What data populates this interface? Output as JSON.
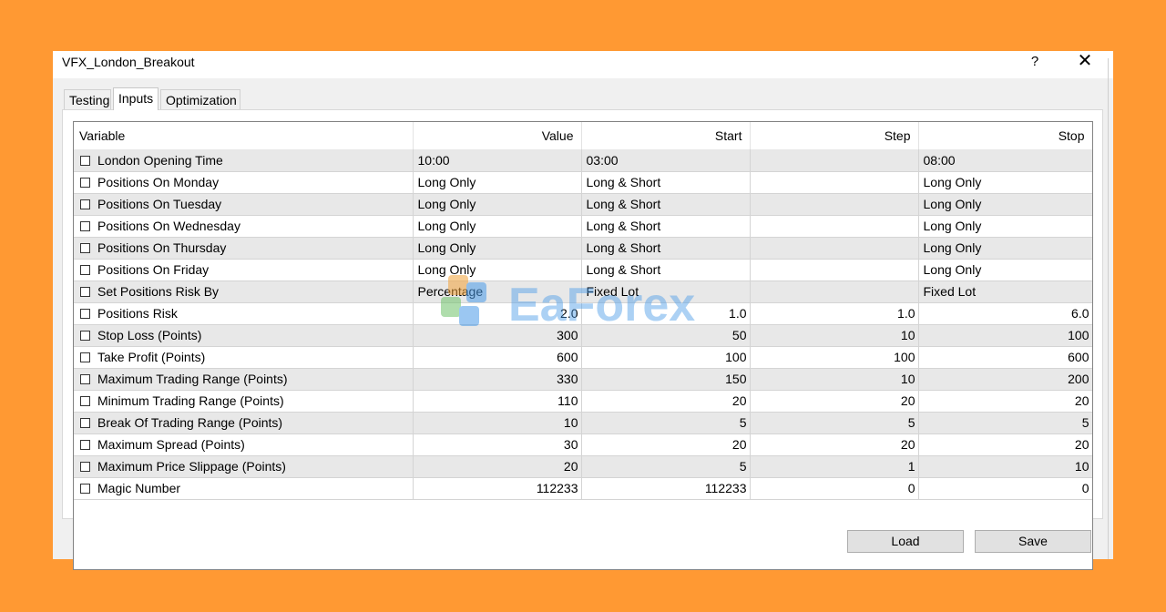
{
  "window": {
    "title": "VFX_London_Breakout",
    "help_label": "?",
    "close_label": "✕"
  },
  "tabs": [
    {
      "label": "Testing",
      "active": false
    },
    {
      "label": "Inputs",
      "active": true
    },
    {
      "label": "Optimization",
      "active": false
    }
  ],
  "table": {
    "headers": [
      "Variable",
      "Value",
      "Start",
      "Step",
      "Stop"
    ],
    "rows": [
      {
        "checked": false,
        "variable": "London Opening Time",
        "value": "10:00",
        "start": "03:00",
        "step": "",
        "stop": "08:00",
        "align": "txt"
      },
      {
        "checked": false,
        "variable": "Positions On Monday",
        "value": "Long Only",
        "start": "Long & Short",
        "step": "",
        "stop": "Long Only",
        "align": "txt"
      },
      {
        "checked": false,
        "variable": "Positions On Tuesday",
        "value": "Long Only",
        "start": "Long & Short",
        "step": "",
        "stop": "Long Only",
        "align": "txt"
      },
      {
        "checked": false,
        "variable": "Positions On Wednesday",
        "value": "Long Only",
        "start": "Long & Short",
        "step": "",
        "stop": "Long Only",
        "align": "txt"
      },
      {
        "checked": false,
        "variable": "Positions On Thursday",
        "value": "Long Only",
        "start": "Long & Short",
        "step": "",
        "stop": "Long Only",
        "align": "txt"
      },
      {
        "checked": false,
        "variable": "Positions On Friday",
        "value": "Long Only",
        "start": "Long & Short",
        "step": "",
        "stop": "Long Only",
        "align": "txt"
      },
      {
        "checked": false,
        "variable": "Set Positions Risk By",
        "value": "Percentage",
        "start": "Fixed Lot",
        "step": "",
        "stop": "Fixed Lot",
        "align": "txt"
      },
      {
        "checked": false,
        "variable": "Positions Risk",
        "value": "2.0",
        "start": "1.0",
        "step": "1.0",
        "stop": "6.0",
        "align": "num"
      },
      {
        "checked": false,
        "variable": "Stop Loss (Points)",
        "value": "300",
        "start": "50",
        "step": "10",
        "stop": "100",
        "align": "num"
      },
      {
        "checked": false,
        "variable": "Take Profit (Points)",
        "value": "600",
        "start": "100",
        "step": "100",
        "stop": "600",
        "align": "num"
      },
      {
        "checked": false,
        "variable": "Maximum Trading Range (Points)",
        "value": "330",
        "start": "150",
        "step": "10",
        "stop": "200",
        "align": "num"
      },
      {
        "checked": false,
        "variable": "Minimum Trading Range (Points)",
        "value": "110",
        "start": "20",
        "step": "20",
        "stop": "20",
        "align": "num"
      },
      {
        "checked": false,
        "variable": "Break Of Trading Range (Points)",
        "value": "10",
        "start": "5",
        "step": "5",
        "stop": "5",
        "align": "num"
      },
      {
        "checked": false,
        "variable": "Maximum Spread (Points)",
        "value": "30",
        "start": "20",
        "step": "20",
        "stop": "20",
        "align": "num"
      },
      {
        "checked": false,
        "variable": "Maximum Price Slippage (Points)",
        "value": "20",
        "start": "5",
        "step": "1",
        "stop": "10",
        "align": "num"
      },
      {
        "checked": false,
        "variable": "Magic Number",
        "value": "112233",
        "start": "112233",
        "step": "0",
        "stop": "0",
        "align": "num"
      }
    ]
  },
  "buttons": {
    "load_label": "Load",
    "save_label": "Save"
  },
  "watermark": {
    "text": "EaForex"
  },
  "colors": {
    "background": "#ff9933",
    "row_alt": "#e8e8e8",
    "watermark_blue": "#4a9be8"
  }
}
